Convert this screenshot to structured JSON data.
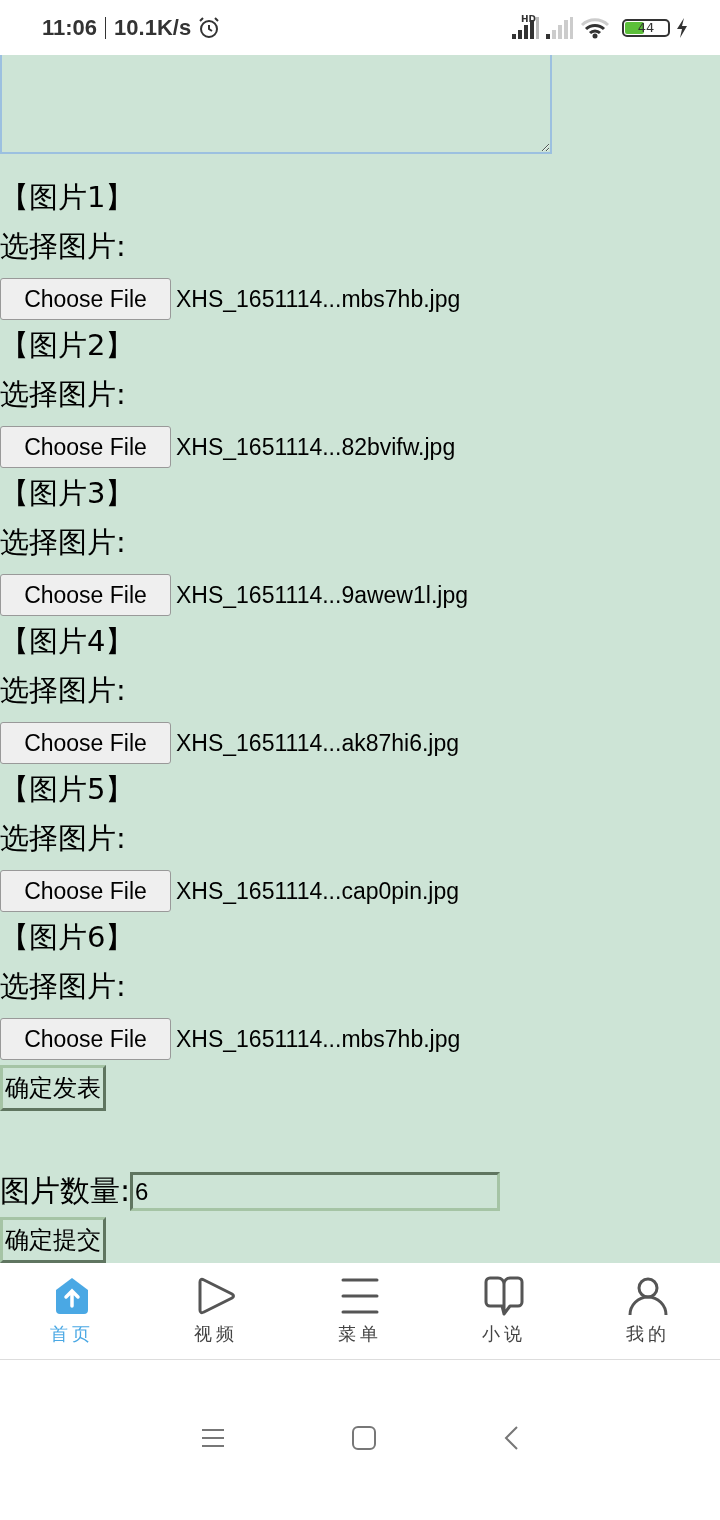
{
  "status_bar": {
    "time": "11:06",
    "speed": "10.1K/s",
    "network_label": "HD",
    "battery": {
      "text": "44",
      "level": 0.44,
      "charging": true
    }
  },
  "images": [
    {
      "label": "【图片1】",
      "prompt": "选择图片:",
      "button": "Choose File",
      "file": "XHS_1651114...mbs7hb.jpg"
    },
    {
      "label": "【图片2】",
      "prompt": "选择图片:",
      "button": "Choose File",
      "file": "XHS_1651114...82bvifw.jpg"
    },
    {
      "label": "【图片3】",
      "prompt": "选择图片:",
      "button": "Choose File",
      "file": "XHS_1651114...9awew1l.jpg"
    },
    {
      "label": "【图片4】",
      "prompt": "选择图片:",
      "button": "Choose File",
      "file": "XHS_1651114...ak87hi6.jpg"
    },
    {
      "label": "【图片5】",
      "prompt": "选择图片:",
      "button": "Choose File",
      "file": "XHS_1651114...cap0pin.jpg"
    },
    {
      "label": "【图片6】",
      "prompt": "选择图片:",
      "button": "Choose File",
      "file": "XHS_1651114...mbs7hb.jpg"
    }
  ],
  "publish_button": "确定发表",
  "count_field": {
    "label": "图片数量:",
    "value": "6"
  },
  "submit_button": "确定提交",
  "tabs": [
    {
      "kind": "home",
      "label": "首页",
      "selected": true
    },
    {
      "kind": "play",
      "label": "视频",
      "selected": false
    },
    {
      "kind": "menu",
      "label": "菜单",
      "selected": false
    },
    {
      "kind": "book",
      "label": "小说",
      "selected": false
    },
    {
      "kind": "person",
      "label": "我的",
      "selected": false
    }
  ]
}
